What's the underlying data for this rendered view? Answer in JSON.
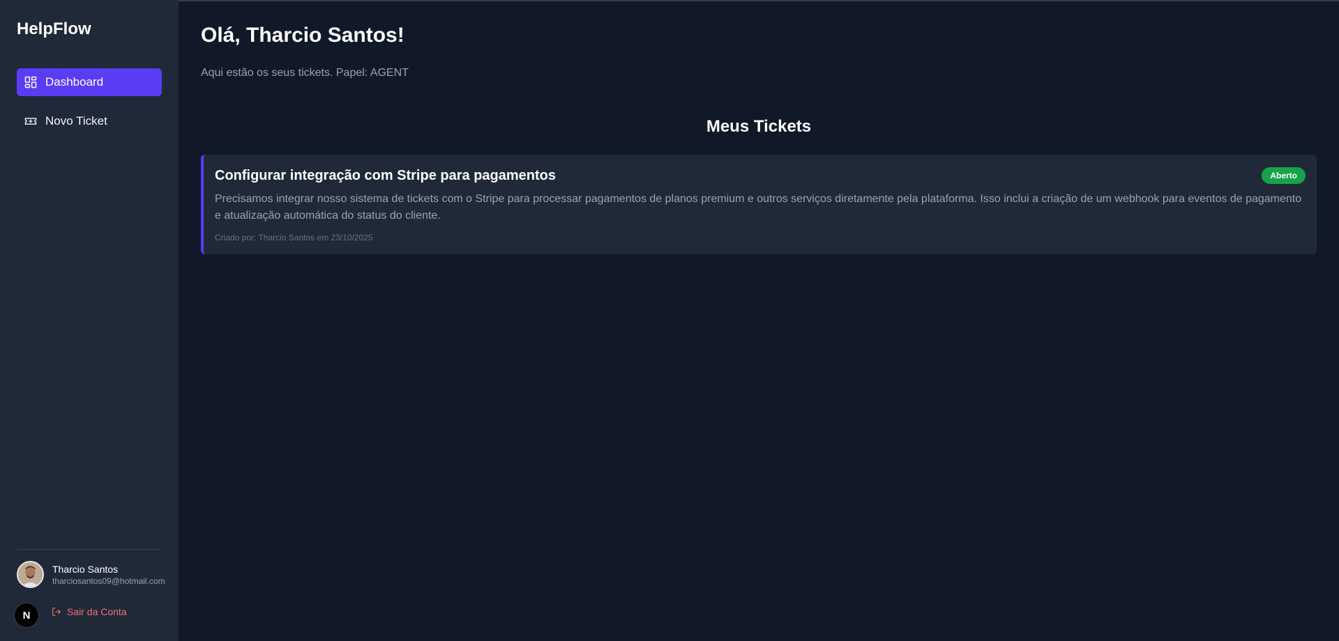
{
  "app": {
    "brand": "HelpFlow"
  },
  "sidebar": {
    "items": [
      {
        "label": "Dashboard",
        "icon": "dashboard-icon",
        "active": true
      },
      {
        "label": "Novo Ticket",
        "icon": "ticket-icon",
        "active": false
      }
    ],
    "user": {
      "name": "Tharcio Santos",
      "email": "tharciosantos09@hotmail.com"
    },
    "logout_label": "Sair da Conta",
    "dev_badge": "N"
  },
  "main": {
    "greeting": "Olá, Tharcio Santos!",
    "subtitle": "Aqui estão os seus tickets. Papel: AGENT",
    "section_title": "Meus Tickets",
    "tickets": [
      {
        "title": "Configurar integração com Stripe para pagamentos",
        "status": "Aberto",
        "description": "Precisamos integrar nosso sistema de tickets com o Stripe para processar pagamentos de planos premium e outros serviços diretamente pela plataforma. Isso inclui a criação de um webhook para eventos de pagamento e atualização automática do status do cliente.",
        "meta": "Criado por: Tharcio Santos em 23/10/2025"
      }
    ]
  },
  "colors": {
    "accent": "#5b3cf5",
    "status_open": "#16a34a",
    "logout": "#f87171",
    "background": "#111827",
    "sidebar": "#1f2937"
  }
}
